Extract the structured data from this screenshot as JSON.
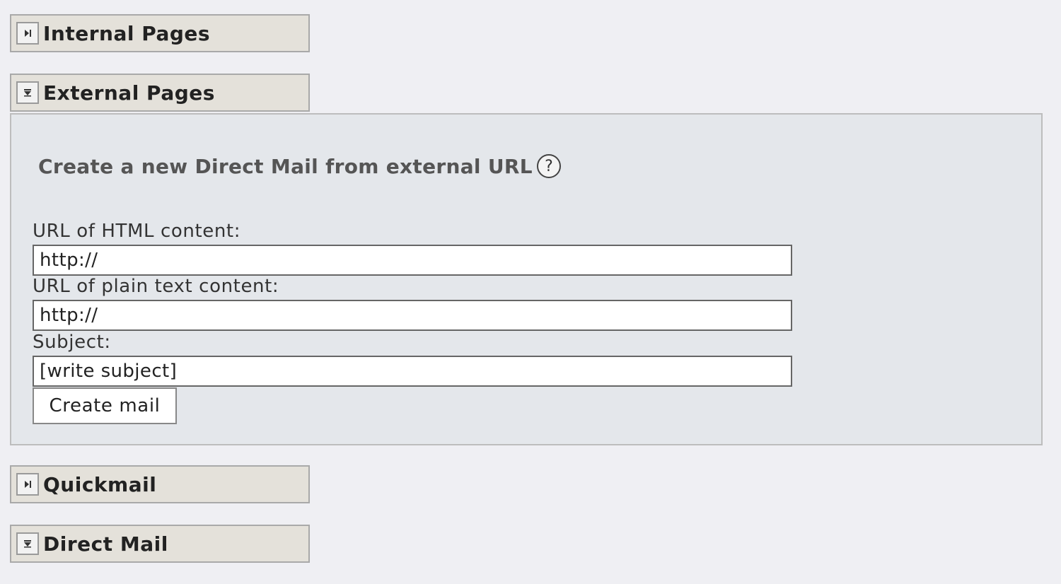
{
  "sections": {
    "internal_pages": {
      "title": "Internal Pages",
      "state": "collapsed"
    },
    "external_pages": {
      "title": "External Pages",
      "state": "expanded"
    },
    "quickmail": {
      "title": "Quickmail",
      "state": "collapsed"
    },
    "direct_mail": {
      "title": "Direct Mail",
      "state": "expanded"
    }
  },
  "external_panel": {
    "heading": "Create a new Direct Mail from external URL",
    "help_glyph": "?",
    "html_url_label": "URL of HTML content:",
    "html_url_value": "http://",
    "plain_url_label": "URL of plain text content:",
    "plain_url_value": "http://",
    "subject_label": "Subject:",
    "subject_value": "[write subject]",
    "create_button_label": "Create mail"
  },
  "icons": {
    "collapsed": "expand-arrow-icon",
    "expanded": "collapse-arrow-icon"
  },
  "colors": {
    "page_bg": "#efeff3",
    "header_bg": "#e4e1da",
    "panel_bg": "#e4e7eb"
  }
}
